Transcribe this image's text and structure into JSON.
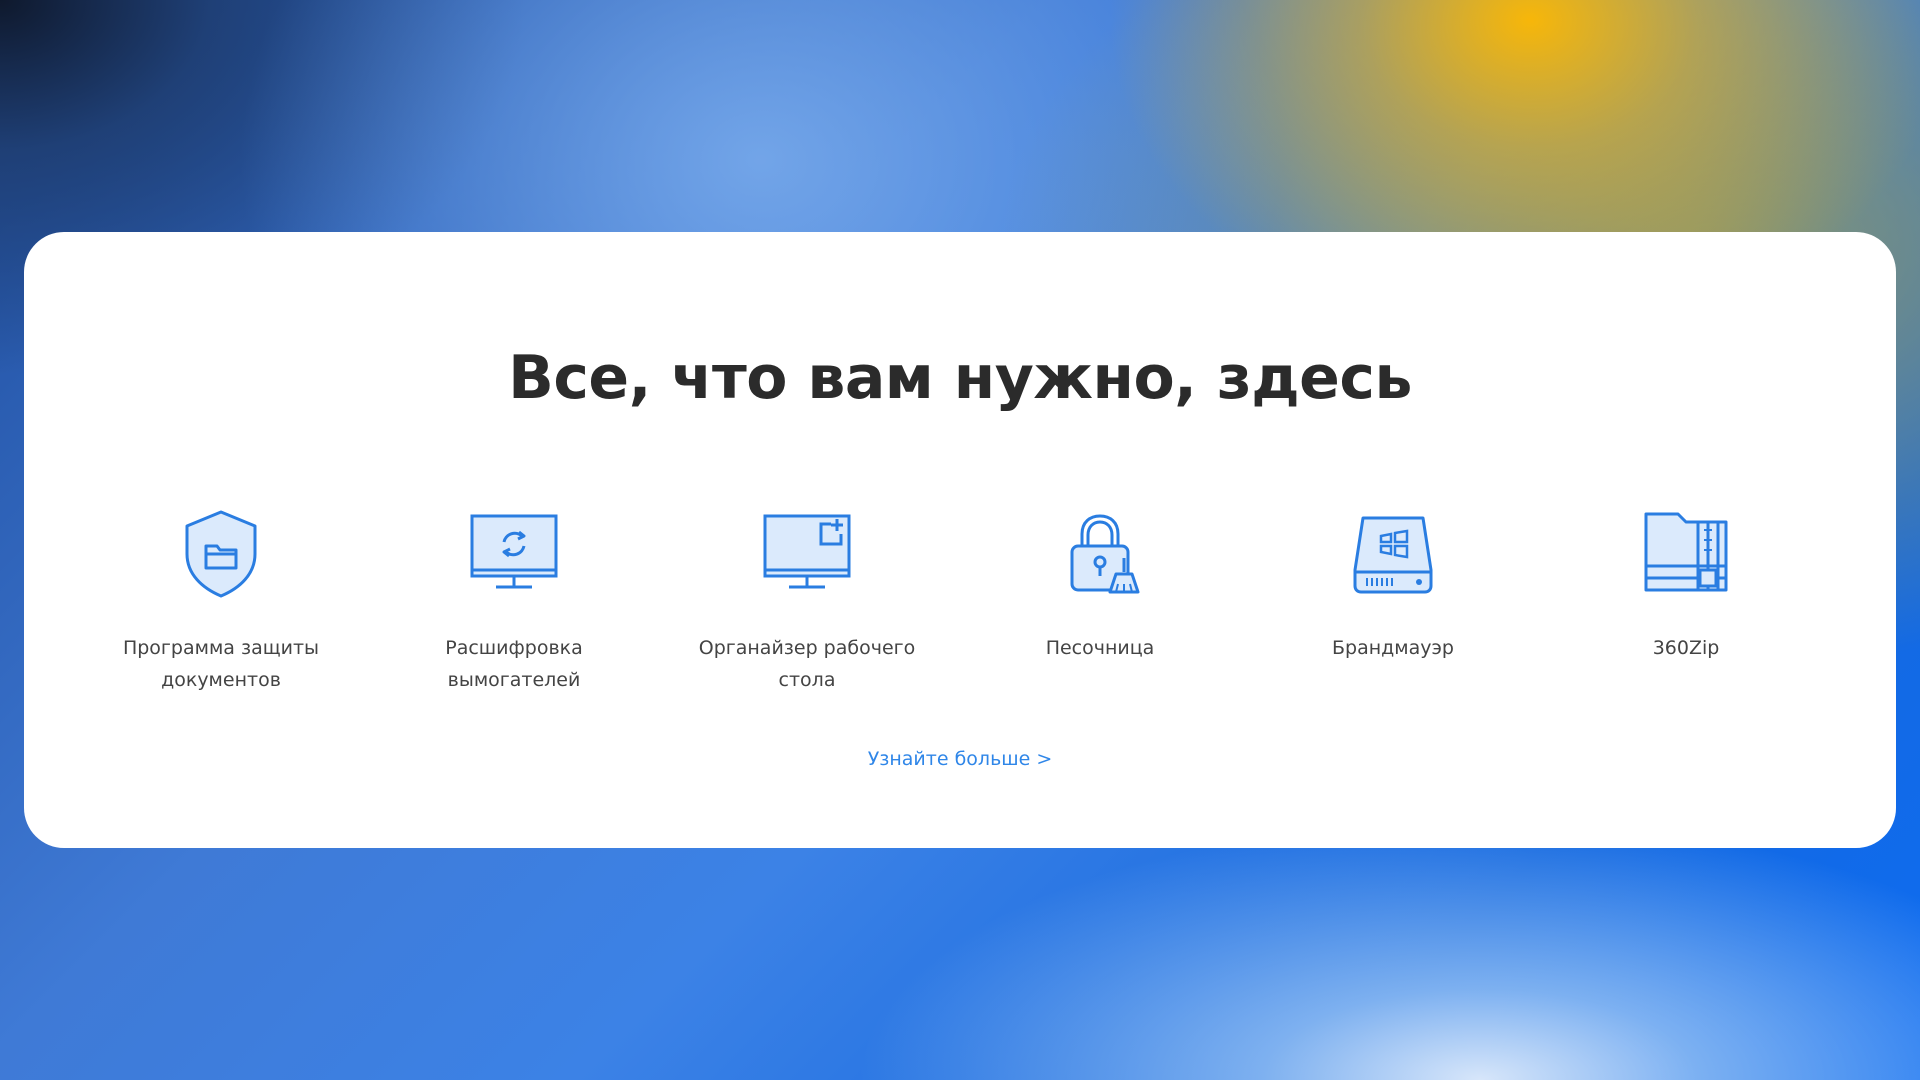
{
  "headline": "Все, что вам нужно, здесь",
  "features": [
    {
      "label": "Программа защиты документов",
      "icon": "shield-folder-icon"
    },
    {
      "label": "Расшифровка вымогателей",
      "icon": "monitor-refresh-icon"
    },
    {
      "label": "Органайзер рабочего стола",
      "icon": "monitor-add-window-icon"
    },
    {
      "label": "Песочница",
      "icon": "padlock-broom-icon"
    },
    {
      "label": "Брандмауэр",
      "icon": "hard-drive-windows-icon"
    },
    {
      "label": "360Zip",
      "icon": "zip-archive-icon"
    }
  ],
  "more_link": "Узнайте больше >",
  "colors": {
    "accent": "#2f86e8",
    "icon_stroke": "#2a7de1",
    "icon_fill": "#dbeafc",
    "headline": "#2b2b2b",
    "label": "#444444",
    "card": "#ffffff"
  }
}
